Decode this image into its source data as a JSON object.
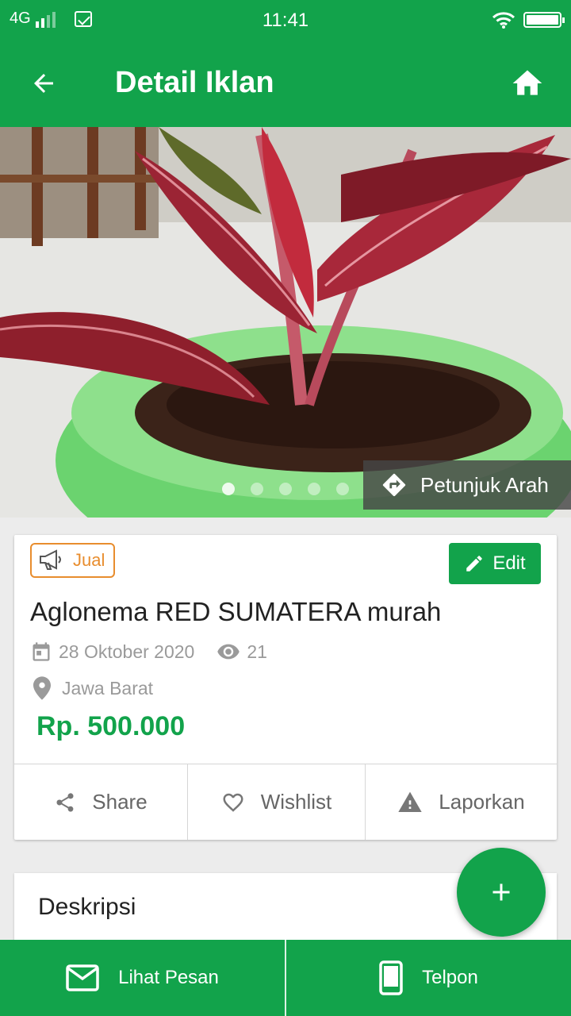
{
  "status_bar": {
    "network": "4G",
    "time": "11:41"
  },
  "app_bar": {
    "title": "Detail Iklan",
    "back_icon": "arrow-left-icon",
    "home_icon": "home-icon"
  },
  "gallery": {
    "image_count": 5,
    "active_index": 0,
    "directions_label": "Petunjuk Arah"
  },
  "listing": {
    "badge": "Jual",
    "edit_label": "Edit",
    "title": "Aglonema RED SUMATERA murah",
    "date": "28 Oktober 2020",
    "views": "21",
    "location": "Jawa Barat",
    "price": "Rp. 500.000"
  },
  "actions": {
    "share": "Share",
    "wishlist": "Wishlist",
    "report": "Laporkan"
  },
  "description": {
    "heading": "Deskripsi"
  },
  "bottom_bar": {
    "messages": "Lihat Pesan",
    "phone": "Telpon"
  },
  "colors": {
    "primary": "#12a34b",
    "badge_orange": "#e88d2e",
    "muted_text": "#9a9a9a"
  }
}
